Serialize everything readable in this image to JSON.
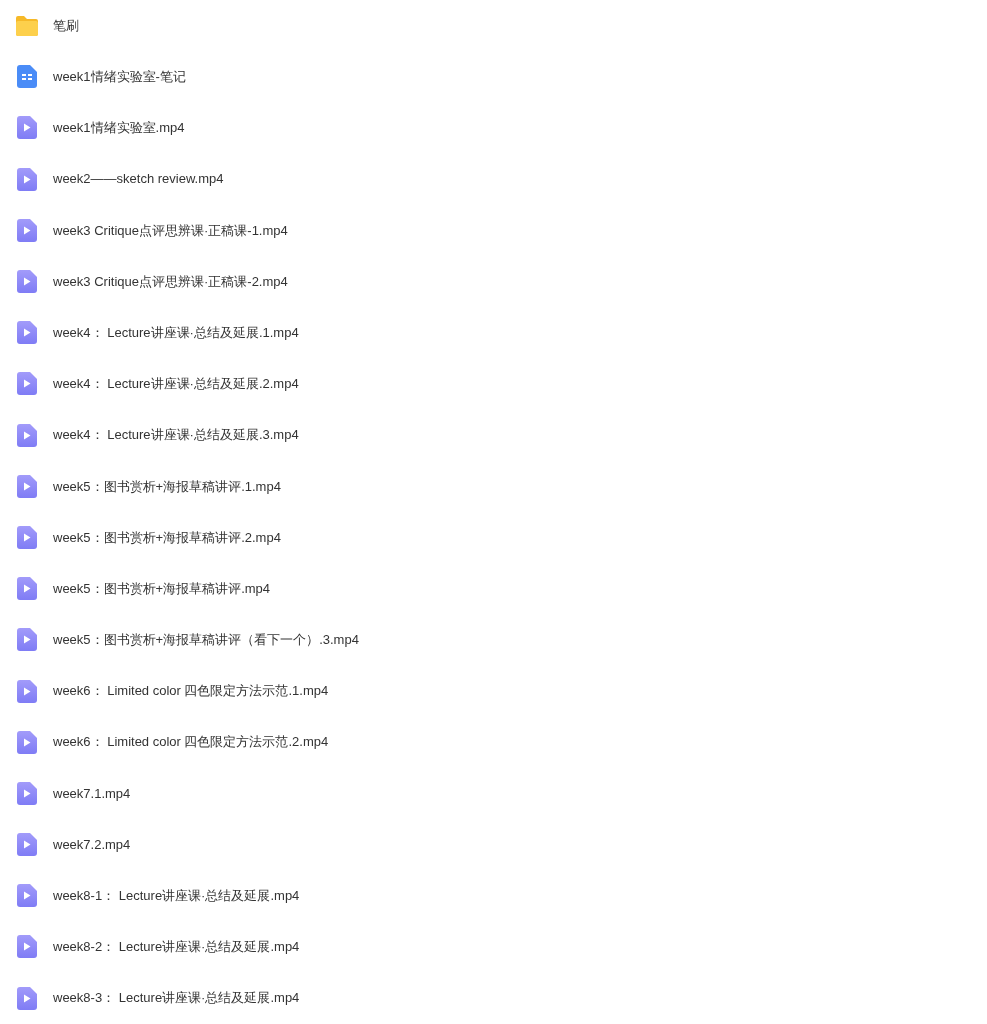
{
  "files": [
    {
      "kind": "folder",
      "name": "笔刷"
    },
    {
      "kind": "doc",
      "name": "week1情绪实验室-笔记"
    },
    {
      "kind": "video",
      "name": "week1情绪实验室.mp4"
    },
    {
      "kind": "video",
      "name": "week2——sketch review.mp4"
    },
    {
      "kind": "video",
      "name": "week3 Critique点评思辨课·正稿课-1.mp4"
    },
    {
      "kind": "video",
      "name": "week3 Critique点评思辨课·正稿课-2.mp4"
    },
    {
      "kind": "video",
      "name": "week4： Lecture讲座课·总结及延展.1.mp4"
    },
    {
      "kind": "video",
      "name": "week4： Lecture讲座课·总结及延展.2.mp4"
    },
    {
      "kind": "video",
      "name": "week4： Lecture讲座课·总结及延展.3.mp4"
    },
    {
      "kind": "video",
      "name": "week5：图书赏析+海报草稿讲评.1.mp4"
    },
    {
      "kind": "video",
      "name": "week5：图书赏析+海报草稿讲评.2.mp4"
    },
    {
      "kind": "video",
      "name": "week5：图书赏析+海报草稿讲评.mp4"
    },
    {
      "kind": "video",
      "name": "week5：图书赏析+海报草稿讲评（看下一个）.3.mp4"
    },
    {
      "kind": "video",
      "name": "week6： Limited color 四色限定方法示范.1.mp4"
    },
    {
      "kind": "video",
      "name": "week6： Limited color 四色限定方法示范.2.mp4"
    },
    {
      "kind": "video",
      "name": "week7.1.mp4"
    },
    {
      "kind": "video",
      "name": "week7.2.mp4"
    },
    {
      "kind": "video",
      "name": "week8-1： Lecture讲座课·总结及延展.mp4"
    },
    {
      "kind": "video",
      "name": "week8-2： Lecture讲座课·总结及延展.mp4"
    },
    {
      "kind": "video",
      "name": "week8-3： Lecture讲座课·总结及延展.mp4"
    }
  ]
}
